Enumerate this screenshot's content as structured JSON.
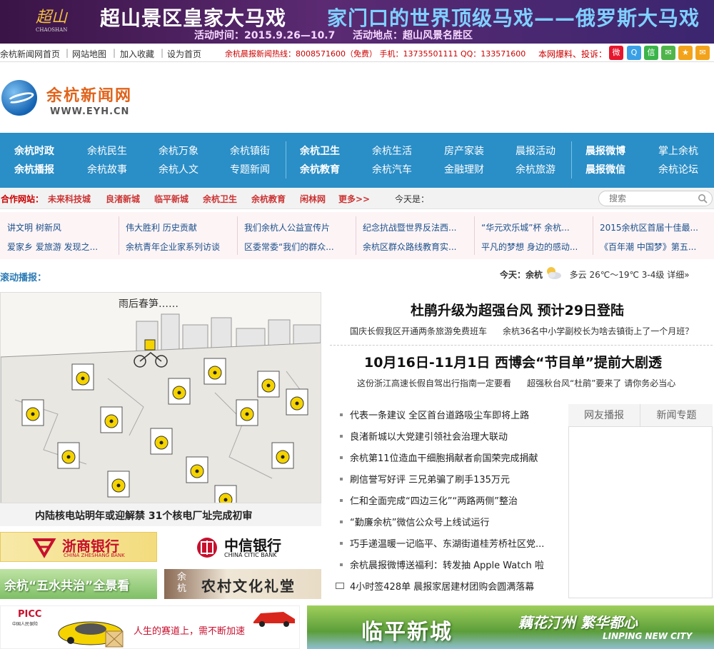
{
  "banner": {
    "logo_text": "超山",
    "logo_small": "CHAOSHAN",
    "title_left": "超山景区皇家大马戏",
    "title_right": "家门口的世界顶级马戏——俄罗斯大马戏",
    "time": "活动时间：2015.9.26—10.7",
    "place": "活动地点：超山风景名胜区"
  },
  "utility": {
    "links": [
      "余杭新闻网首页",
      "网站地图",
      "加入收藏",
      "设为首页"
    ],
    "hotline": "余杭晨报新闻热线：8008571600（免费） 手机：13735501111 QQ：133571600",
    "report_label": "本网爆料、投诉："
  },
  "share_icons": [
    {
      "name": "weibo-icon",
      "glyph": "微",
      "color": "#e6162d"
    },
    {
      "name": "qq-icon",
      "glyph": "Q",
      "color": "#3aa0e6"
    },
    {
      "name": "wechat-icon",
      "glyph": "信",
      "color": "#3bb54a"
    },
    {
      "name": "chat-icon",
      "glyph": "✉",
      "color": "#4fb54a"
    },
    {
      "name": "star-icon",
      "glyph": "★",
      "color": "#f2a31b"
    },
    {
      "name": "mail-icon",
      "glyph": "✉",
      "color": "#f2a31b"
    }
  ],
  "logo": {
    "name": "余杭新闻网",
    "url": "WWW.EYH.CN"
  },
  "nav": {
    "row1": [
      "余杭时政",
      "余杭民生",
      "余杭万象",
      "余杭镇街",
      "余杭卫生",
      "余杭生活",
      "房产家装",
      "晨报活动",
      "晨报微博",
      "掌上余杭"
    ],
    "row2": [
      "余杭播报",
      "余杭故事",
      "余杭人文",
      "专题新闻",
      "余杭教育",
      "余杭汽车",
      "金融理财",
      "余杭旅游",
      "晨报微信",
      "余杭论坛"
    ]
  },
  "partners": {
    "label": "合作网站：",
    "links": [
      "未来科技城",
      "良渚新城",
      "临平新城",
      "余杭卫生",
      "余杭教育",
      "闲林网",
      "更多>>"
    ],
    "today": "今天是：",
    "search_placeholder": "搜索"
  },
  "topics": {
    "row1": [
      "讲文明 树新风",
      "伟大胜利 历史贡献",
      "我们余杭人公益宣传片",
      "纪念抗战暨世界反法西...",
      "“华元欢乐城”杯 余杭...",
      "2015余杭区首届十佳最..."
    ],
    "row2": [
      "爱家乡 爱旅游 发现之...",
      "余杭青年企业家系列访谈",
      "区委常委“我们的群众...",
      "余杭区群众路线教育实...",
      "平凡的梦想 身边的感动...",
      "《百年潮 中国梦》第五..."
    ]
  },
  "scroll_label": "滚动播报：",
  "weather": {
    "prefix": "今天：余杭",
    "condition": "多云 26℃～19℃ 3-4级",
    "detail": "详细»"
  },
  "hero": {
    "cartoon_title": "雨后春笋……",
    "caption": "内陆核电站明年或迎解禁 31个核电厂址完成初审"
  },
  "headlines": [
    {
      "title": "杜鹃升级为超强台风 预计29日登陆",
      "subs": [
        "国庆长假我区开通两条旅游免费班车",
        "余杭36名中小学副校长为啥去镇街上了一个月班？"
      ]
    },
    {
      "title": "10月16日-11月1日 西博会“节目单”提前大剧透",
      "subs": [
        "这份浙江高速长假自驾出行指南一定要看",
        "超强秋台风“杜鹃”要来了 请你务必当心"
      ]
    }
  ],
  "news_list": [
    "代表一条建议 全区首台道路吸尘车即将上路",
    "良渚新城以大党建引领社会治理大联动",
    "余杭第11位造血干细胞捐献者俞国荣完成捐献",
    "刷信誉写好评 三兄弟骗了刷手135万元",
    "仁和全面完成“四边三化”“两路两侧”整治",
    "“勤廉余杭”微信公众号上线试运行",
    "巧手递温暖一记临平、东湖街道桂芳桥社区党...",
    "余杭晨报微博送福利：转发抽 Apple Watch 啦",
    "4小时签428单 晨报家居建材团购会圆满落幕"
  ],
  "tabs": [
    "网友播报",
    "新闻专题"
  ],
  "ads": {
    "zheshang": {
      "cn": "浙商银行",
      "en": "CHINA ZHESHANG BANK"
    },
    "citic": {
      "cn": "中信银行",
      "en": "CHINA CITIC BANK"
    },
    "water": "余杭“五水共治”全景看",
    "culture": {
      "side": "余杭",
      "main": "农村文化礼堂"
    },
    "picc": {
      "logo": "PICC",
      "sub": "中国人民保险",
      "slogan": "人生的赛道上，需不断加速"
    },
    "linping": {
      "main": "临平新城",
      "slogan": "藕花汀州 繁华都心",
      "en": "LINPING NEW CITY"
    }
  }
}
